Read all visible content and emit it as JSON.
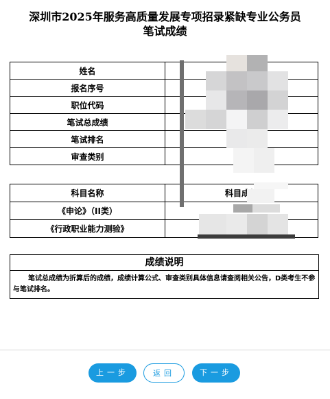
{
  "page": {
    "title_line1": "深圳市2025年服务高质量发展专项招录紧缺专业公务员",
    "title_line2": "笔试成绩"
  },
  "info_table": {
    "rows": [
      {
        "label": "姓名",
        "value": ""
      },
      {
        "label": "报名序号",
        "value": ""
      },
      {
        "label": "职位代码",
        "value": ""
      },
      {
        "label": "笔试总成绩",
        "value": ""
      },
      {
        "label": "笔试排名",
        "value": ""
      },
      {
        "label": "审查类别",
        "value": ""
      }
    ]
  },
  "subject_table": {
    "header": {
      "name": "科目名称",
      "score": "科目成绩"
    },
    "rows": [
      {
        "name": "《申论》（II类）",
        "score": ""
      },
      {
        "name": "《行政职业能力测验》",
        "score": ""
      }
    ]
  },
  "notes": {
    "title": "成绩说明",
    "body": "笔试总成绩为折算后的成绩，成绩计算公式、审查类别具体信息请查阅相关公告，D类考生不参与笔试排名。"
  },
  "buttons": {
    "prev": "上一步",
    "back": "返回",
    "next": "下一步"
  },
  "colors": {
    "accent": "#1a9be0",
    "border": "#000000",
    "redaction_dark": "#6f6f6f"
  }
}
